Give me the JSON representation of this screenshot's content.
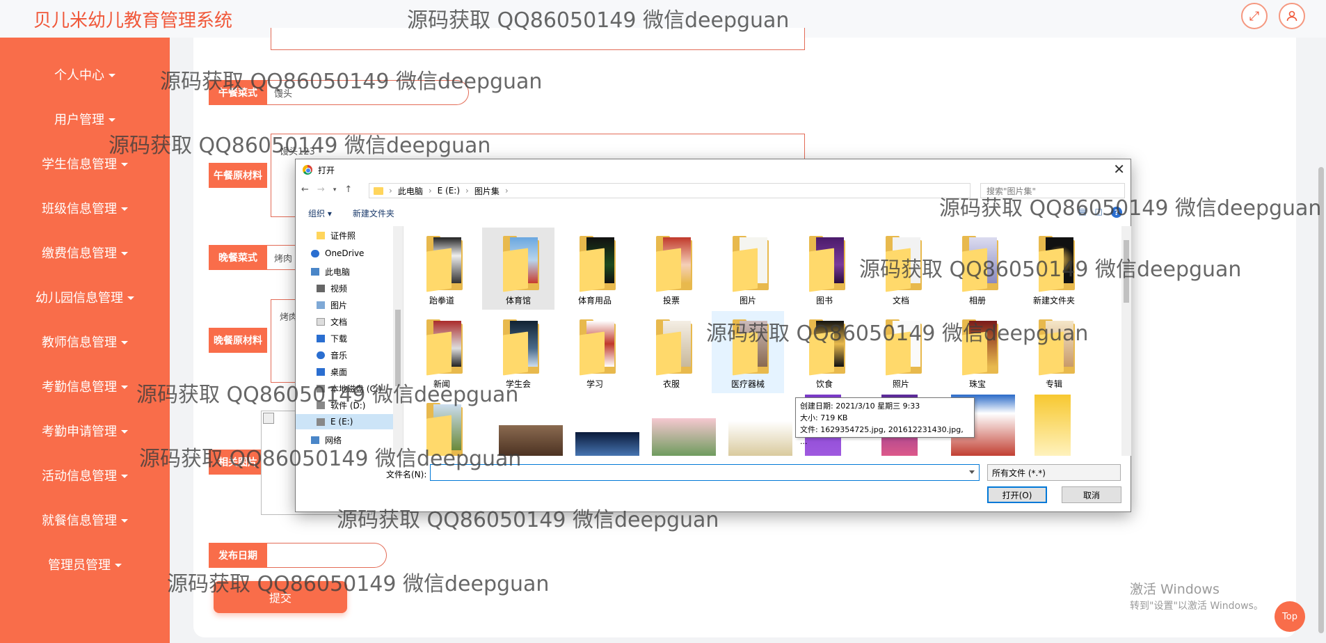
{
  "app": {
    "title": "贝儿米幼儿教育管理系统"
  },
  "sidebar": {
    "items": [
      {
        "label": "个人中心"
      },
      {
        "label": "用户管理"
      },
      {
        "label": "学生信息管理"
      },
      {
        "label": "班级信息管理"
      },
      {
        "label": "缴费信息管理"
      },
      {
        "label": "幼儿园信息管理"
      },
      {
        "label": "教师信息管理"
      },
      {
        "label": "考勤信息管理"
      },
      {
        "label": "考勤申请管理"
      },
      {
        "label": "活动信息管理"
      },
      {
        "label": "就餐信息管理"
      },
      {
        "label": "管理员管理"
      }
    ]
  },
  "form": {
    "lunch_menu_label": "午餐菜式",
    "lunch_menu_value": "馒头",
    "lunch_material_label": "午餐原材料",
    "lunch_material_value": "馒头123",
    "dinner_menu_label": "晚餐菜式",
    "dinner_menu_value": "烤肉",
    "dinner_material_label": "晚餐原材料",
    "dinner_material_value": "烤肉",
    "image_label": "相关图片",
    "date_label": "发布日期",
    "date_value": "",
    "submit_label": "提交"
  },
  "dialog": {
    "title": "打开",
    "close": "✕",
    "breadcrumbs": [
      "此电脑",
      "E (E:)",
      "图片集"
    ],
    "search_placeholder": "搜索\"图片集\"",
    "organize": "组织 ▾",
    "new_folder": "新建文件夹",
    "help": "?",
    "nav_items": [
      "证件照",
      "OneDrive",
      "此电脑",
      "视频",
      "图片",
      "文档",
      "下载",
      "音乐",
      "桌面",
      "本地磁盘 (C:)",
      "软件 (D:)",
      "E (E:)",
      "网络"
    ],
    "files_row1": [
      "跆拳道",
      "体育馆",
      "体育用品",
      "投票",
      "图片",
      "图书",
      "文档",
      "相册",
      "新建文件夹"
    ],
    "files_row2": [
      "新闻",
      "学生会",
      "学习",
      "衣服",
      "医疗器械",
      "饮食",
      "照片",
      "珠宝",
      "专辑"
    ],
    "tooltip": {
      "created": "创建日期: 2021/3/10 星期三 9:33",
      "size": "大小: 719 KB",
      "files": "文件: 1629354725.jpg, 201612231430.jpg, ..."
    },
    "filename_label": "文件名(N):",
    "filename_value": "",
    "filetype": "所有文件 (*.*)",
    "open_button": "打开(O)",
    "cancel_button": "取消"
  },
  "overlay": {
    "activate_title": "激活 Windows",
    "activate_sub": "转到\"设置\"以激活 Windows。",
    "top_button": "Top"
  },
  "watermark": "源码获取 QQ86050149 微信deepguan",
  "colors": {
    "accent": "#f96d4a",
    "title": "#f0583a"
  }
}
